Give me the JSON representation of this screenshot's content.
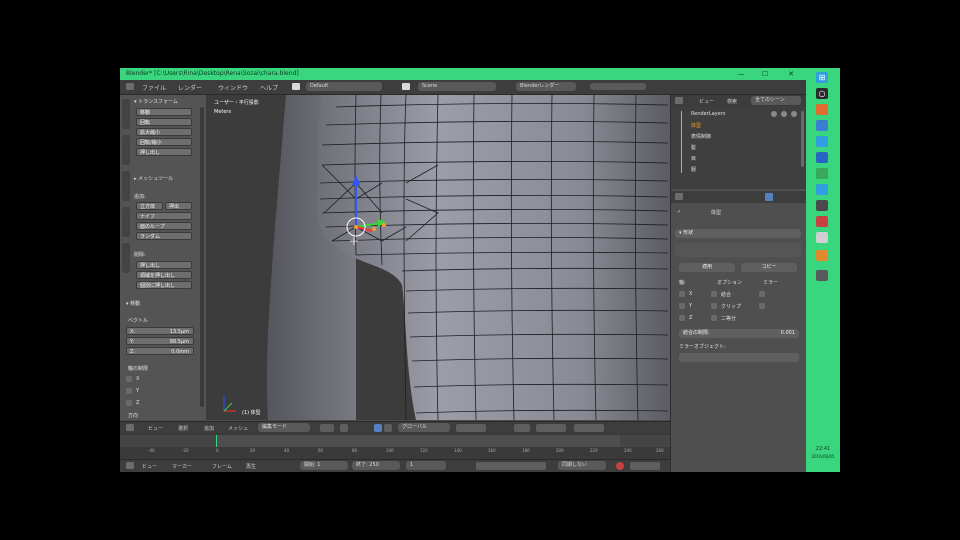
{
  "window": {
    "title": "Blender* [C:\\Users\\Rina\\Desktop\\Rena\\Sozai\\chara.blend]",
    "min_glyph": "—",
    "max_glyph": "☐",
    "close_glyph": "✕"
  },
  "menubar": {
    "items": [
      "ファイル",
      "レンダー",
      "ウィンドウ",
      "ヘルプ"
    ],
    "layout_value": "Default",
    "scene_value": "Scene",
    "engine_value": "Blenderレンダー"
  },
  "toolshelf": {
    "transform_header": "▾ トランスフォーム",
    "transform_buttons": [
      "移動",
      "回転",
      "拡大縮小",
      "回転/縮小",
      "押し出し"
    ],
    "deform_header": "▸ メッシュツール",
    "add_header": "追加:",
    "add_buttons": [
      "立方体",
      "押出",
      "ナイフ",
      "面のループ",
      "ランダム"
    ],
    "remove_header": "削除:",
    "remove_buttons": [
      "押し出し",
      "領域を押し出し",
      "個別に押し出し"
    ],
    "history_header": "▾ 移動",
    "vector_header": "ベクトル",
    "vector_x": "X:",
    "vector_x_value": "13.5μm",
    "vector_y": "Y:",
    "vector_y_value": "88.5μm",
    "vector_z": "Z:",
    "vector_z_value": "0.0mm",
    "constraint_header": "軸の制限",
    "constraint_x": "X",
    "constraint_y": "Y",
    "constraint_z": "Z",
    "orientation_header": "方向"
  },
  "viewport": {
    "view_label": "ユーザー・平行投影",
    "unit_label": "Meters",
    "object_label": "(1) 体型"
  },
  "viewport_header": {
    "items": [
      "ビュー",
      "選択",
      "追加",
      "メッシュ"
    ],
    "mode_value": "編集モード",
    "pivot_value": "グローバル"
  },
  "timeline": {
    "ticks": [
      "-40",
      "-20",
      "0",
      "20",
      "40",
      "60",
      "80",
      "100",
      "120",
      "140",
      "160",
      "180",
      "200",
      "220",
      "240",
      "260"
    ],
    "items": [
      "ビュー",
      "マーカー",
      "フレーム",
      "再生"
    ],
    "start_label": "開始:",
    "start_value": "1",
    "end_label": "終了:",
    "end_value": "250",
    "current_value": "1",
    "sync_value": "同期しない"
  },
  "properties": {
    "outliner_tabs": [
      "ビュー",
      "検索",
      "全てのシーン"
    ],
    "outliner_items": [
      "RenderLayers",
      "体型",
      "表情制御",
      "髪",
      "目",
      "服"
    ],
    "object_name": "体型",
    "modifier_header": "▾ 形状",
    "modifier_buttons": [
      "適用",
      "コピー"
    ],
    "options_header": "オプション",
    "mirror_header": "ミラー",
    "axis_x": "X",
    "axis_y": "Y",
    "axis_z": "Z",
    "option_clip": "クリップ",
    "option_merge": "結合",
    "option_bisect": "二等分",
    "mirror_object_label": "ミラーオブジェクト:",
    "merge_limit_label": "結合の制限:",
    "merge_limit_value": "0.001"
  },
  "taskbar": {
    "time": "22:41",
    "date": "2016/06/05"
  },
  "colors": {
    "accent_green": "#3ad67f",
    "select_orange": "#f0a030",
    "gizmo_z": "#2d56ff",
    "gizmo_y": "#3ad63a",
    "gizmo_x": "#ff3030"
  }
}
